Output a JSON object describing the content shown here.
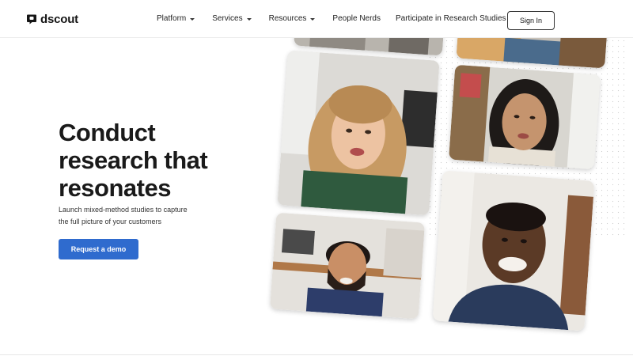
{
  "brand": {
    "name": "dscout",
    "icon": "speech-bubble-logo-icon"
  },
  "nav": {
    "items": [
      {
        "label": "Platform",
        "has_dropdown": true
      },
      {
        "label": "Services",
        "has_dropdown": true
      },
      {
        "label": "Resources",
        "has_dropdown": true
      },
      {
        "label": "People Nerds",
        "has_dropdown": false
      },
      {
        "label": "Participate in Research Studies",
        "has_dropdown": false
      }
    ],
    "signin_label": "Sign In"
  },
  "hero": {
    "headline_lines": [
      "Conduct",
      "research that",
      "resonates"
    ],
    "subtext_lines": [
      "Launch mixed-method studies to capture",
      "the full picture of your customers"
    ],
    "cta_label": "Request a demo"
  },
  "colors": {
    "accent": "#2f6bce",
    "text": "#1a1a1a",
    "border": "#ececec"
  }
}
